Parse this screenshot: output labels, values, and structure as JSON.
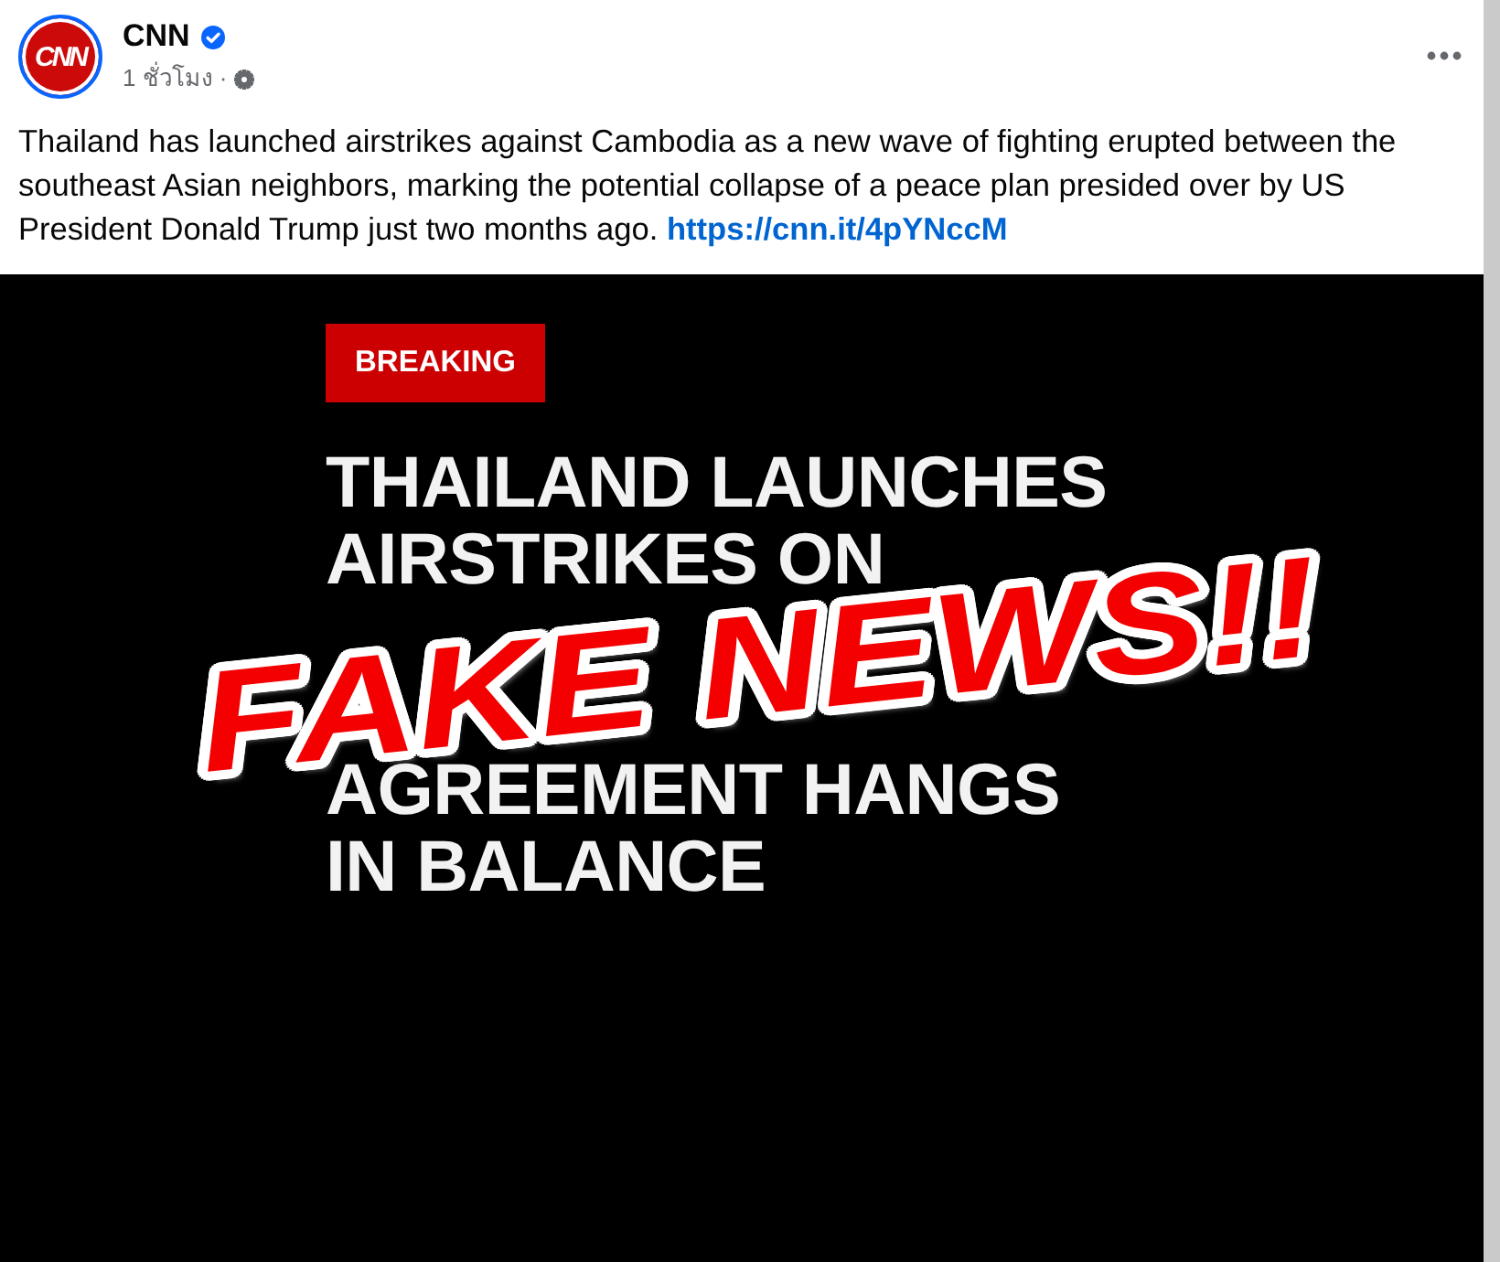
{
  "post": {
    "author": {
      "logo_text": "CNN",
      "name": "CNN",
      "verified": true
    },
    "time": "1 ชั่วโมง",
    "separator": "·",
    "caption": "Thailand has launched airstrikes against Cambodia as a new wave of fighting erupted between the southeast Asian neighbors, marking the potential collapse of a peace plan presided over by US President Donald Trump just two months ago.",
    "link": "https://cnn.it/4pYNccM"
  },
  "image": {
    "badge": "BREAKING",
    "headline_top": [
      "THAILAND LAUNCHES",
      "AIRSTRIKES ON"
    ],
    "headline_bottom": [
      "AGREEMENT HANGS",
      "IN BALANCE"
    ],
    "stamp": "FAKE NEWS!!"
  }
}
